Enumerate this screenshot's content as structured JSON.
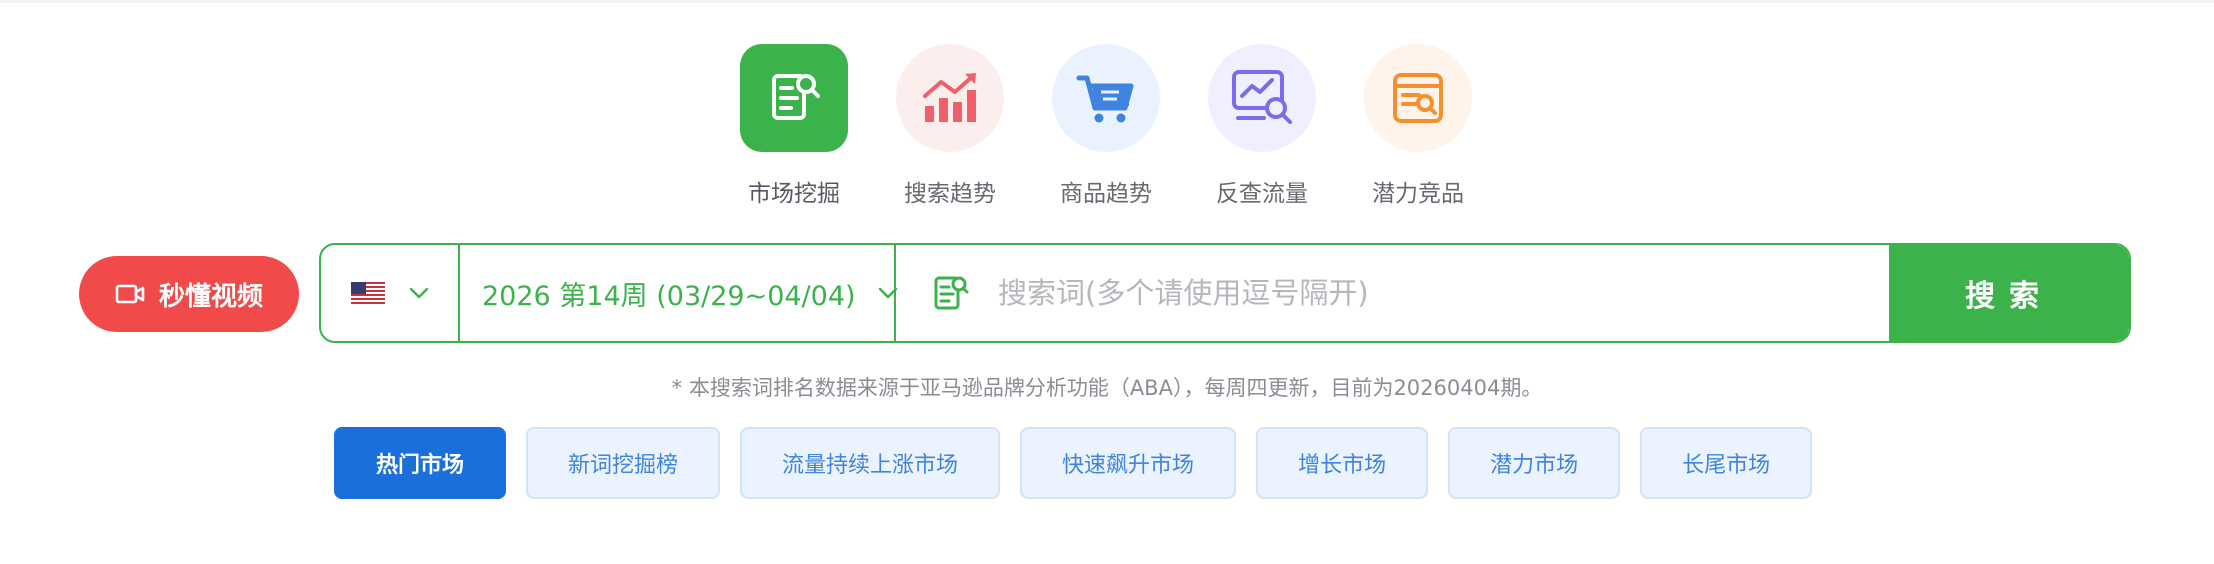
{
  "tools": [
    {
      "label": "市场挖掘",
      "icon": "market-mining-icon",
      "bg": "#3bb34a",
      "active": true
    },
    {
      "label": "搜索趋势",
      "icon": "search-trend-icon",
      "bg": "#fdeeee",
      "active": false
    },
    {
      "label": "商品趋势",
      "icon": "product-cart-icon",
      "bg": "#eaf2ff",
      "active": false
    },
    {
      "label": "反查流量",
      "icon": "traffic-lookup-icon",
      "bg": "#efefff",
      "active": false
    },
    {
      "label": "潜力竞品",
      "icon": "potential-product-icon",
      "bg": "#fff3ea",
      "active": false
    }
  ],
  "video_button": {
    "label": "秒懂视频",
    "icon": "video-camera-icon"
  },
  "search": {
    "country_flag": "us-flag-icon",
    "week": "2026 第14周 (03/29~04/04)",
    "placeholder": "搜索词(多个请使用逗号隔开)",
    "button": "搜索"
  },
  "notice": "* 本搜索词排名数据来源于亚马逊品牌分析功能（ABA），每周四更新，目前为20260404期。",
  "tabs": [
    {
      "label": "热门市场",
      "active": true
    },
    {
      "label": "新词挖掘榜",
      "active": false
    },
    {
      "label": "流量持续上涨市场",
      "active": false
    },
    {
      "label": "快速飙升市场",
      "active": false
    },
    {
      "label": "增长市场",
      "active": false
    },
    {
      "label": "潜力市场",
      "active": false
    },
    {
      "label": "长尾市场",
      "active": false
    }
  ],
  "colors": {
    "primary_green": "#3bb34a",
    "video_red": "#f04a4a",
    "active_tab_blue": "#1a6fdb",
    "tab_text_blue": "#3f85e0"
  }
}
